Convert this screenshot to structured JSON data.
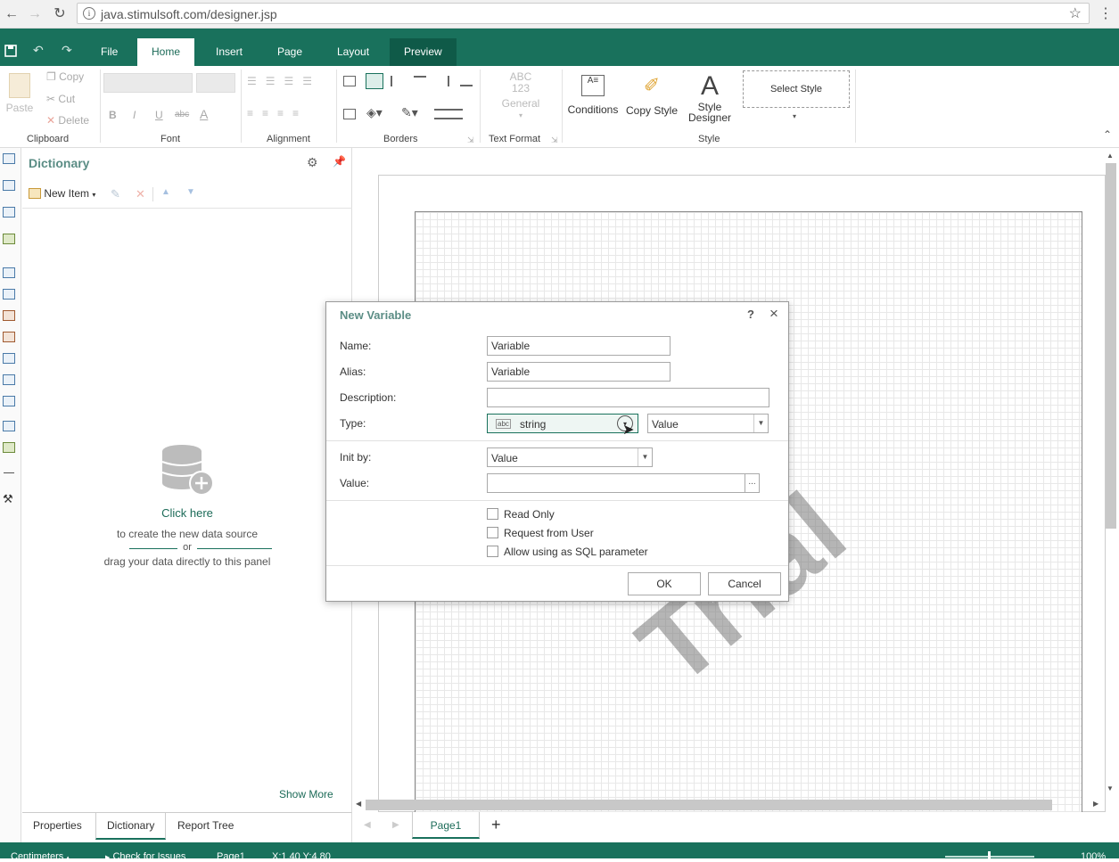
{
  "browser": {
    "url": "java.stimulsoft.com/designer.jsp"
  },
  "app": {
    "tabs": [
      "File",
      "Home",
      "Insert",
      "Page",
      "Layout",
      "Preview"
    ],
    "accent": "#19715c"
  },
  "ribbon": {
    "clipboard": {
      "paste": "Paste",
      "copy": "Copy",
      "cut": "Cut",
      "delete": "Delete",
      "label": "Clipboard"
    },
    "font": {
      "label": "Font",
      "bold": "B",
      "italic": "I",
      "underline": "U",
      "strike": "abc",
      "color": "A"
    },
    "alignment": {
      "label": "Alignment"
    },
    "borders": {
      "label": "Borders"
    },
    "text_format": {
      "abc": "ABC",
      "num": "123",
      "general": "General",
      "label": "Text Format"
    },
    "style": {
      "conditions": "Conditions",
      "copy_style": "Copy Style",
      "style_designer_1": "Style",
      "style_designer_2": "Designer",
      "select_style": "Select Style",
      "label": "Style"
    }
  },
  "dictionary": {
    "title": "Dictionary",
    "new_item": "New Item",
    "click_here": "Click here",
    "create_text": "to create the new data source",
    "or": "or",
    "drag_text": "drag your data directly to this panel",
    "show_more": "Show More"
  },
  "bottom_tabs": [
    "Properties",
    "Dictionary",
    "Report Tree"
  ],
  "canvas": {
    "watermark": "Trial",
    "page_tab": "Page1"
  },
  "status": {
    "units": "Centimeters",
    "check": "Check for Issues",
    "page": "Page1",
    "coords": "X:1.40 Y:4.80",
    "zoom": "100%"
  },
  "dialog": {
    "title": "New Variable",
    "help": "?",
    "close": "×",
    "name_label": "Name:",
    "name_value": "Variable",
    "alias_label": "Alias:",
    "alias_value": "Variable",
    "description_label": "Description:",
    "description_value": "",
    "type_label": "Type:",
    "type_value": "string",
    "type_badge": "abc",
    "type_kind": "Value",
    "init_label": "Init by:",
    "init_value": "Value",
    "value_label": "Value:",
    "value_value": "",
    "ellipsis": "...",
    "read_only": "Read Only",
    "request_from_user": "Request from User",
    "allow_sql": "Allow using as SQL parameter",
    "ok": "OK",
    "cancel": "Cancel"
  }
}
